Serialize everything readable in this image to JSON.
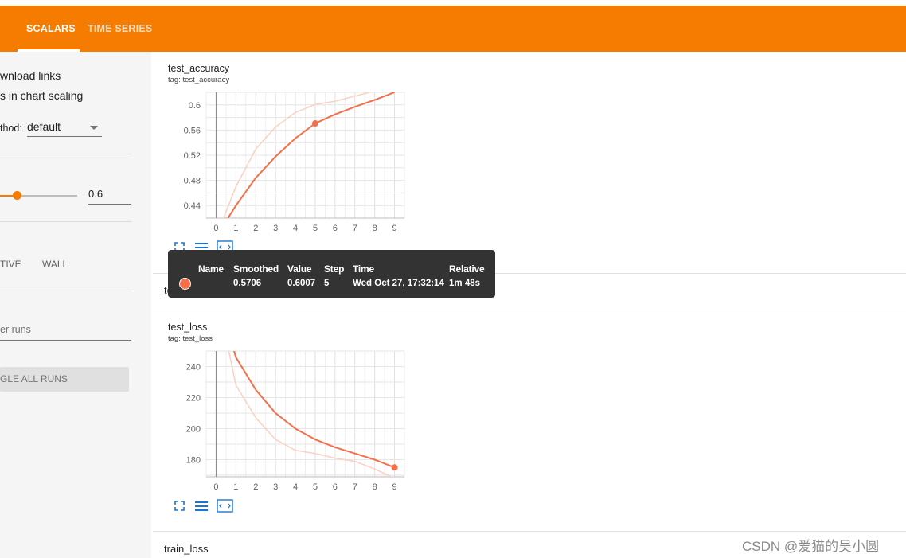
{
  "topbar": {
    "tabs": [
      {
        "label": "SCALARS",
        "active": true
      },
      {
        "label": "TIME SERIES",
        "active": false
      }
    ],
    "color": "#f57c00"
  },
  "sidebar": {
    "download_links_label": "wnload links",
    "chart_scaling_label": "s in chart scaling",
    "tooltip_method_label": "thod:",
    "tooltip_method_value": "default",
    "smoothing_value": "0.6",
    "horizontal_axis_options": [
      "TIVE",
      "WALL"
    ],
    "filter_runs_placeholder": "er runs",
    "toggle_all_runs_label": "GLE ALL RUNS"
  },
  "cards": {
    "test_accuracy": {
      "title": "test_accuracy",
      "tag": "tag: test_accuracy"
    },
    "test_loss": {
      "title": "test_loss",
      "tag": "tag: test_loss"
    }
  },
  "section_headers": {
    "test_loss": "test_loss",
    "train_loss": "train_loss"
  },
  "tooltip": {
    "headers": [
      "Name",
      "Smoothed",
      "Value",
      "Step",
      "Time",
      "Relative"
    ],
    "row": {
      "smoothed": "0.5706",
      "value": "0.6007",
      "step": "5",
      "time": "Wed Oct 27, 17:32:14",
      "relative": "1m 48s"
    },
    "run_color": "#f4704a"
  },
  "watermark": "CSDN @爱猫的吴小圆",
  "chart_data": [
    {
      "type": "line",
      "title": "test_accuracy",
      "x": [
        0,
        1,
        2,
        3,
        4,
        5,
        6,
        7,
        8,
        9
      ],
      "xticks": [
        "0",
        "1",
        "2",
        "3",
        "4",
        "5",
        "6",
        "7",
        "8",
        "9"
      ],
      "yticks": [
        "0.44",
        "0.48",
        "0.52",
        "0.56",
        "0.6"
      ],
      "ylim": [
        0.42,
        0.62
      ],
      "xlim": [
        -0.5,
        9.5
      ],
      "series": [
        {
          "role": "raw",
          "color": "#fad1c2",
          "values": [
            0.39,
            0.47,
            0.53,
            0.565,
            0.588,
            0.6007,
            0.606,
            0.614,
            0.622,
            0.63
          ]
        },
        {
          "role": "smoothed",
          "color": "#f4704a",
          "values": [
            0.39,
            0.44,
            0.484,
            0.518,
            0.547,
            0.5706,
            0.585,
            0.597,
            0.608,
            0.62
          ]
        }
      ],
      "highlight_step": 5
    },
    {
      "type": "line",
      "title": "test_loss",
      "x": [
        0,
        1,
        2,
        3,
        4,
        5,
        6,
        7,
        8,
        9
      ],
      "xticks": [
        "0",
        "1",
        "2",
        "3",
        "4",
        "5",
        "6",
        "7",
        "8",
        "9"
      ],
      "yticks": [
        "180",
        "200",
        "220",
        "240"
      ],
      "ylim": [
        169,
        250
      ],
      "xlim": [
        -0.5,
        9.5
      ],
      "series": [
        {
          "role": "raw",
          "color": "#fad1c2",
          "values": [
            290,
            228,
            207,
            193,
            186,
            184,
            181,
            179,
            174,
            168
          ]
        },
        {
          "role": "smoothed",
          "color": "#f4704a",
          "values": [
            290,
            246,
            225,
            210,
            200,
            193,
            188,
            184,
            180,
            175
          ]
        }
      ],
      "highlight_step": 9
    }
  ]
}
